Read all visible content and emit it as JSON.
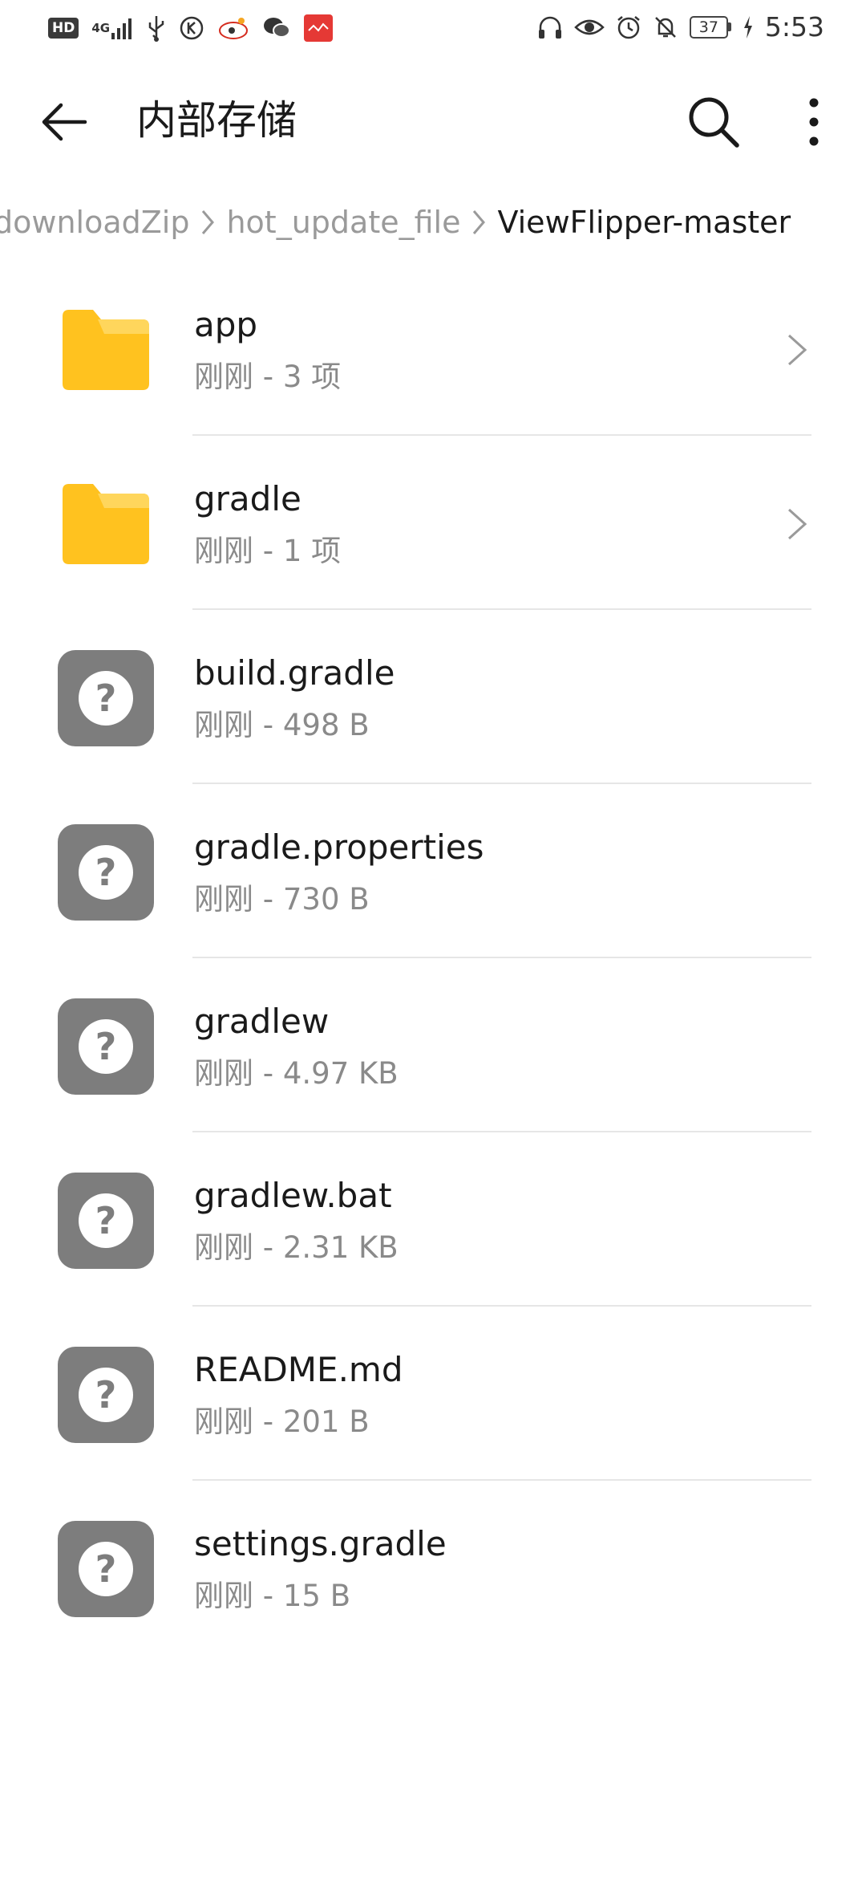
{
  "status_bar": {
    "hd": "HD",
    "network": "4G",
    "battery": "37",
    "time": "5:53",
    "left_icons": [
      "hd-badge",
      "signal-icon",
      "usb-icon",
      "k-app-icon",
      "sina-weibo-icon",
      "wechat-icon",
      "notification-app-icon"
    ],
    "right_icons": [
      "headphones-icon",
      "eye-icon",
      "alarm-icon",
      "mute-bell-icon",
      "battery-icon",
      "charging-icon"
    ]
  },
  "app_bar": {
    "title": "内部存储"
  },
  "breadcrumb": [
    {
      "label": "downloadZip"
    },
    {
      "label": "hot_update_file"
    },
    {
      "label": "ViewFlipper-master"
    }
  ],
  "files": [
    {
      "name": "app",
      "meta": "刚刚 - 3 项",
      "type": "folder"
    },
    {
      "name": "gradle",
      "meta": "刚刚 - 1 项",
      "type": "folder"
    },
    {
      "name": "build.gradle",
      "meta": "刚刚 - 498 B",
      "type": "unknown"
    },
    {
      "name": "gradle.properties",
      "meta": "刚刚 - 730 B",
      "type": "unknown"
    },
    {
      "name": "gradlew",
      "meta": "刚刚 - 4.97 KB",
      "type": "unknown"
    },
    {
      "name": "gradlew.bat",
      "meta": "刚刚 - 2.31 KB",
      "type": "unknown"
    },
    {
      "name": "README.md",
      "meta": "刚刚 - 201 B",
      "type": "unknown"
    },
    {
      "name": "settings.gradle",
      "meta": "刚刚 - 15 B",
      "type": "unknown"
    }
  ],
  "colors": {
    "folder": "#FFC21F",
    "folder_tab": "#FFD65C",
    "unknown_file": "#7D7D7D",
    "secondary_text": "#8A8A8A"
  }
}
